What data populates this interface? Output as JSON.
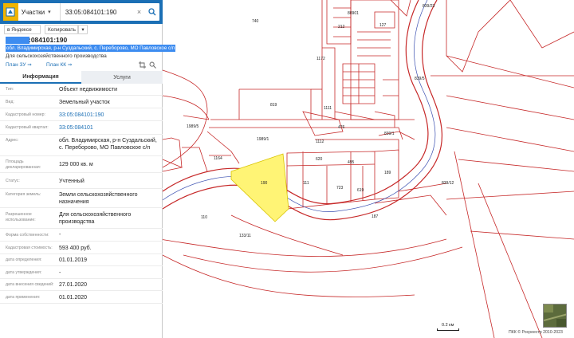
{
  "search": {
    "type_label": "Участки",
    "query": "33:05:084101:190"
  },
  "toolbar": {
    "yandex_label": "в Яндексе",
    "copy_label": "Копировать"
  },
  "object": {
    "number": ":084101:190",
    "address": "обл. Владимирская, р-н Суздальский, с. Переборово, МО Павловское с/п",
    "purpose": "Для сельскохозяйственного производства",
    "plan_zu": "План ЗУ",
    "plan_kk": "План КК"
  },
  "tabs": {
    "info": "Информация",
    "services": "Услуги"
  },
  "rows": [
    {
      "label": "Тип:",
      "value": "Объект недвижимости"
    },
    {
      "label": "Вид:",
      "value": "Земельный участок"
    },
    {
      "label": "Кадастровый номер:",
      "value": "33:05:084101:190"
    },
    {
      "label": "Кадастровый квартал:",
      "value": "33:05:084101"
    },
    {
      "label": "Адрес:",
      "value": "обл. Владимирская, р-н Суздальский, с. Переборово, МО Павловское с/п"
    },
    {
      "label": "Площадь декларированная:",
      "value": "129 000 кв. м"
    },
    {
      "label": "Статус:",
      "value": "Учтенный"
    },
    {
      "label": "Категория земель:",
      "value": "Земли сельскохозяйственного назначения"
    },
    {
      "label": "Разрешенное использование:",
      "value": "Для сельскохозяйственного производства"
    },
    {
      "label": "Форма собственности:",
      "value": "-"
    },
    {
      "label": "Кадастровая стоимость:",
      "value": "593 400 руб."
    },
    {
      "label": "дата определения:",
      "value": "01.01.2019"
    },
    {
      "label": "дата утверждения:",
      "value": "-"
    },
    {
      "label": "дата внесения сведений:",
      "value": "27.01.2020"
    },
    {
      "label": "дата применения:",
      "value": "01.01.2020"
    }
  ],
  "map": {
    "parcel_labels": [
      "740",
      "80901",
      "212",
      "127",
      "839/23",
      "1172",
      "1111",
      "819",
      "476",
      "839/5",
      "1989/5",
      "1989/1",
      "1112",
      "839/1",
      "1164",
      "620",
      "495",
      "190",
      "111",
      "723",
      "619",
      "189",
      "839/12",
      "110",
      "187",
      "133/11"
    ],
    "scale_label": "0.2 км",
    "copyright": "ПКК © Росреестр 2010-2023"
  },
  "colors": {
    "header": "#1b6fb5",
    "parcel_border": "#c62828",
    "selected_parcel": "#fff475",
    "river": "#2a3f9e"
  }
}
